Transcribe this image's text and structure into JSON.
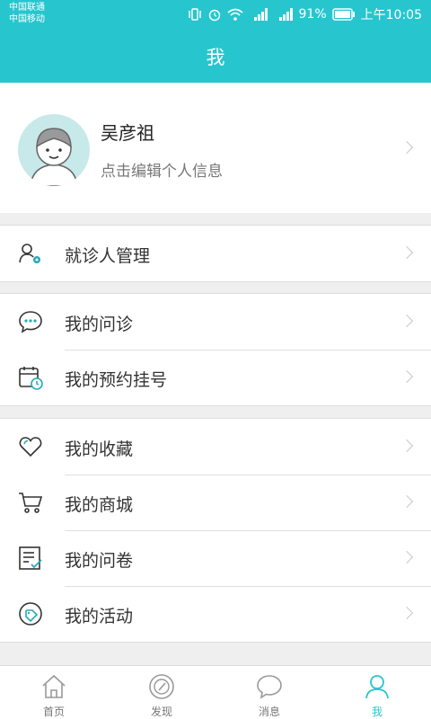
{
  "status_bar": {
    "carrier_1": "中国联通",
    "carrier_2": "中国移动",
    "battery_text": "91%",
    "time": "上午10:05",
    "icons": [
      "vibrate-icon",
      "alarm-icon",
      "wifi-icon",
      "signal-4g-icon",
      "signal-2g-icon",
      "battery-icon"
    ]
  },
  "header": {
    "title": "我"
  },
  "profile": {
    "name": "吴彦祖",
    "subtitle": "点击编辑个人信息",
    "avatar_icon": "default-avatar-icon"
  },
  "menu_groups": [
    [
      {
        "label": "就诊人管理",
        "icon": "patient-settings-icon"
      }
    ],
    [
      {
        "label": "我的问诊",
        "icon": "chat-bubble-icon"
      },
      {
        "label": "我的预约挂号",
        "icon": "calendar-clock-icon"
      }
    ],
    [
      {
        "label": "我的收藏",
        "icon": "heart-icon"
      },
      {
        "label": "我的商城",
        "icon": "cart-icon"
      },
      {
        "label": "我的问卷",
        "icon": "questionnaire-icon"
      },
      {
        "label": "我的活动",
        "icon": "tag-icon"
      }
    ]
  ],
  "tab_bar": {
    "tabs": [
      {
        "label": "首页",
        "icon": "home-icon"
      },
      {
        "label": "发现",
        "icon": "discover-icon"
      },
      {
        "label": "消息",
        "icon": "message-icon"
      },
      {
        "label": "我",
        "icon": "person-icon"
      }
    ],
    "active_index": 3
  },
  "colors": {
    "accent": "#27c6cf",
    "background": "#efefef",
    "icon_teal": "#27a9b8"
  }
}
